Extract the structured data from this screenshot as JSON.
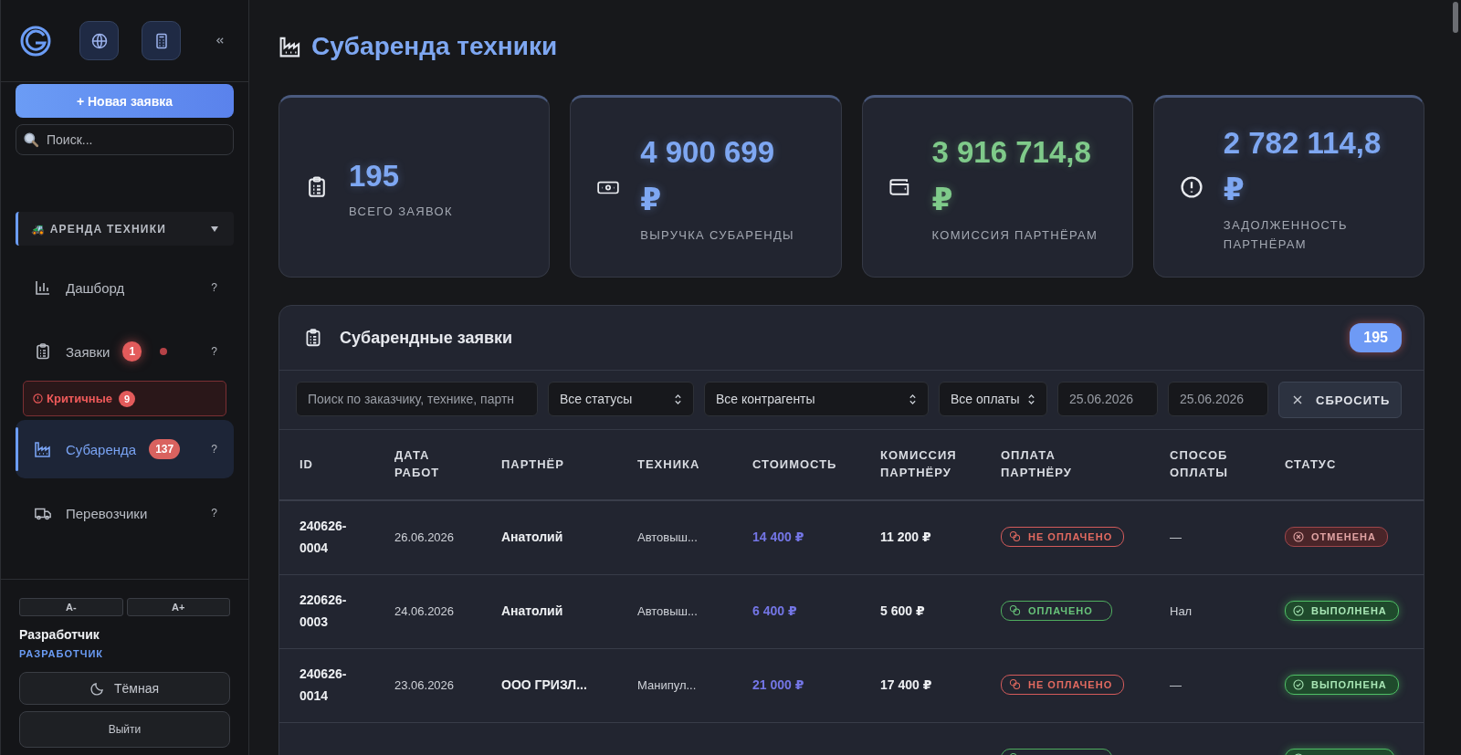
{
  "sidebar": {
    "new_button": "+ Новая заявка",
    "search": {
      "placeholder": "Поиск..."
    },
    "section": {
      "label": "АРЕНДА ТЕХНИКИ",
      "icon": "🚜",
      "expanded": true
    },
    "items": [
      {
        "kind": "nav",
        "label": "Дашборд",
        "selected": false,
        "help": "?"
      },
      {
        "kind": "nav",
        "label": "Заявки",
        "selected": false,
        "badge": "1",
        "dot": true,
        "help": "?"
      },
      {
        "kind": "alert",
        "label": "Критичные",
        "badge": "9"
      },
      {
        "kind": "nav",
        "label": "Субаренда",
        "selected": true,
        "badge": "137",
        "help": "?"
      },
      {
        "kind": "nav",
        "label": "Перевозчики",
        "selected": false,
        "help": "?"
      }
    ],
    "font_buttons": [
      "A-",
      "A+"
    ],
    "user": {
      "name": "Разработчик",
      "role": "РАЗРАБОТЧИК"
    },
    "theme_button": "Тёмная",
    "logout": "Выйти"
  },
  "page": {
    "title": "Субаренда техники"
  },
  "stats": [
    {
      "value": "195",
      "label": "ВСЕГО ЗАЯВОК",
      "color": "#7ea7f2"
    },
    {
      "value": "4 900 699",
      "currency": "₽",
      "label": "ВЫРУЧКА СУБАРЕНДЫ",
      "color": "#7ea7f2"
    },
    {
      "value": "3 916 714,8",
      "currency": "₽",
      "label": "КОМИССИЯ ПАРТНЁРАМ",
      "color": "#7fca8a"
    },
    {
      "value": "2 782 114,8",
      "currency": "₽",
      "label": "ЗАДОЛЖЕННОСТЬ ПАРТНЁРАМ",
      "color": "#7ea7f2"
    }
  ],
  "table": {
    "title": "Субарендные заявки",
    "count": "195",
    "filters": {
      "search_placeholder": "Поиск по заказчику, технике, партн",
      "selects": [
        "Все статусы",
        "Все контрагенты",
        "Все оплаты"
      ],
      "date_from": "25.06.2026",
      "date_to": "25.06.2026",
      "reset": "СБРОСИТЬ"
    },
    "columns": [
      "ID",
      "ДАТА РАБОТ",
      "ПАРТНЁР",
      "ТЕХНИКА",
      "СТОИМОСТЬ",
      "КОМИССИЯ ПАРТНЁРУ",
      "ОПЛАТА ПАРТНЁРУ",
      "СПОСОБ ОПЛАТЫ",
      "СТАТУС"
    ],
    "rows": [
      {
        "id": "240626-0004",
        "date": "26.06.2026",
        "partner": "Анатолий",
        "equipment": "Автовыш...",
        "cost": "14 400 ₽",
        "commission": "11 200 ₽",
        "payment": {
          "kind": "unpaid",
          "label": "НЕ ОПЛАЧЕНО"
        },
        "method": "—",
        "status": {
          "kind": "cancelled",
          "label": "ОТМЕНЕНА"
        }
      },
      {
        "id": "220626-0003",
        "date": "24.06.2026",
        "partner": "Анатолий",
        "equipment": "Автовыш...",
        "cost": "6 400 ₽",
        "commission": "5 600 ₽",
        "payment": {
          "kind": "paid",
          "label": "ОПЛАЧЕНО"
        },
        "method": "Нал",
        "status": {
          "kind": "done",
          "label": "ВЫПОЛНЕНА"
        }
      },
      {
        "id": "240626-0014",
        "date": "23.06.2026",
        "partner": "ООО ГРИЗЛ...",
        "equipment": "Манипул...",
        "cost": "21 000 ₽",
        "commission": "17 400 ₽",
        "payment": {
          "kind": "unpaid",
          "label": "НЕ ОПЛАЧЕНО"
        },
        "method": "—",
        "status": {
          "kind": "done",
          "label": "ВЫПОЛНЕНА"
        }
      },
      {
        "payment": {
          "kind": "paid"
        },
        "status": {
          "kind": "done"
        }
      }
    ]
  }
}
